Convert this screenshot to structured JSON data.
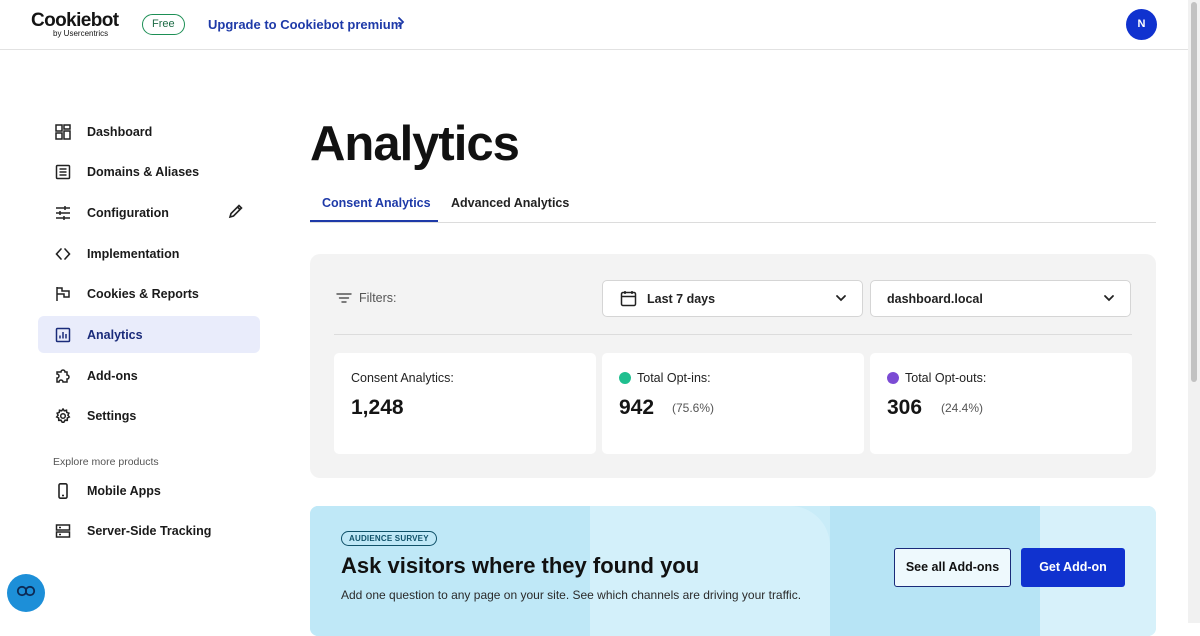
{
  "header": {
    "logo_text": "Cookiebot",
    "logo_subtext": "by Usercentrics",
    "plan_badge": "Free",
    "upgrade_link": "Upgrade to Cookiebot premium",
    "avatar_initial": "N",
    "accent_color": "#1032cf"
  },
  "sidebar": {
    "items": [
      {
        "label": "Dashboard",
        "icon": "dashboard-grid-icon"
      },
      {
        "label": "Domains & Aliases",
        "icon": "list-document-icon"
      },
      {
        "label": "Configuration",
        "icon": "sliders-icon"
      },
      {
        "label": "Implementation",
        "icon": "code-brackets-icon"
      },
      {
        "label": "Cookies & Reports",
        "icon": "flag-icon"
      },
      {
        "label": "Analytics",
        "icon": "bar-chart-icon",
        "active": true
      },
      {
        "label": "Add-ons",
        "icon": "puzzle-icon"
      },
      {
        "label": "Settings",
        "icon": "gear-icon"
      }
    ],
    "explore_heading": "Explore more products",
    "explore_items": [
      {
        "label": "Mobile Apps",
        "icon": "mobile-phone-icon"
      },
      {
        "label": "Server-Side Tracking",
        "icon": "server-icon"
      }
    ]
  },
  "main": {
    "title": "Analytics",
    "tabs": [
      {
        "label": "Consent Analytics",
        "active": true
      },
      {
        "label": "Advanced Analytics",
        "active": false
      }
    ],
    "filters": {
      "label": "Filters:",
      "date_range": "Last 7 days",
      "domain": "dashboard.local"
    },
    "cards": [
      {
        "label": "Consent Analytics:",
        "value": "1,248",
        "percent": ""
      },
      {
        "label": "Total Opt-ins:",
        "value": "942",
        "percent": "(75.6%)",
        "dot_color": "#1fbf8f"
      },
      {
        "label": "Total Opt-outs:",
        "value": "306",
        "percent": "(24.4%)",
        "dot_color": "#7b4bd4"
      }
    ]
  },
  "banner": {
    "badge": "AUDIENCE SURVEY",
    "title": "Ask visitors where they found you",
    "description": "Add one question to any page on your site. See which channels are driving your traffic.",
    "secondary_button": "See all Add-ons",
    "primary_button": "Get Add-on"
  }
}
